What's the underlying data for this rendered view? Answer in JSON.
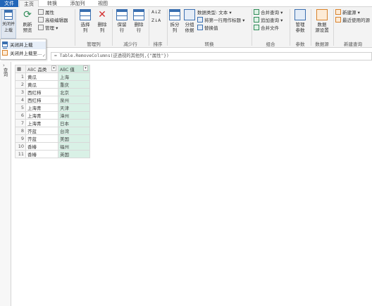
{
  "tabs": [
    "文件",
    "主页",
    "转换",
    "添加列",
    "视图"
  ],
  "ribbon": {
    "close_load": "关闭并\n上载",
    "refresh_preview": "刷新\n预览",
    "properties": "属性",
    "advanced_editor": "高级编辑器",
    "manage": "管理",
    "choose_columns": "选择\n列",
    "remove_columns": "删除\n列",
    "keep_rows": "保留\n行",
    "remove_rows": "删除\n行",
    "sort_asc": "A↓Z",
    "split_column": "拆分\n列",
    "group_by": "分组\n依据",
    "data_type": "数据类型: 文本",
    "first_row_headers": "将第一行用作标题",
    "replace_values": "替换值",
    "merge_queries": "合并查询",
    "append_queries": "追加查询",
    "combine_files": "合并文件",
    "manage_params": "管理\n参数",
    "data_source_settings": "数据\n源设置",
    "new_source": "新建源",
    "recent_sources": "最近使用的源",
    "groups": {
      "manage_columns": "管理列",
      "reduce_rows": "减少行",
      "sort": "排序",
      "transform": "转换",
      "combine": "组合",
      "parameters": "参数",
      "data_sources": "数据源",
      "new_query": "新建查询"
    }
  },
  "popup": {
    "item1": "关闭并上载",
    "item2": "关闭并上载至..."
  },
  "formula": "= Table.RemoveColumns(逆透视的其他列,{\"属性\"})",
  "queries_label": "查询",
  "grid": {
    "col1": "品类",
    "col2": "值",
    "col1_icon": "ABC",
    "col2_icon": "ABC",
    "rows": [
      [
        "1",
        "黄瓜",
        "上海"
      ],
      [
        "2",
        "黄瓜",
        "重庆"
      ],
      [
        "3",
        "西红柿",
        "北京"
      ],
      [
        "4",
        "西红柿",
        "泉州"
      ],
      [
        "5",
        "上海青",
        "天津"
      ],
      [
        "6",
        "上海青",
        "漳州"
      ],
      [
        "7",
        "上海青",
        "日本"
      ],
      [
        "8",
        "芥蓝",
        "台湾"
      ],
      [
        "9",
        "芥蓝",
        "美国"
      ],
      [
        "10",
        "香椿",
        "福州"
      ],
      [
        "11",
        "香椿",
        "英国"
      ]
    ]
  }
}
